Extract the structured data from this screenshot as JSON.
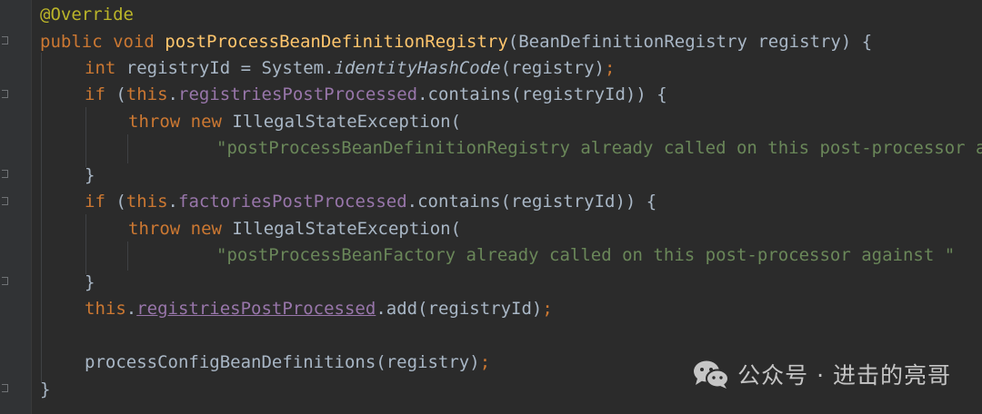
{
  "code": {
    "lines": [
      [
        {
          "cls": "t-ann",
          "text": "@Override"
        }
      ],
      [
        {
          "cls": "t-kw",
          "text": "public void "
        },
        {
          "cls": "t-fn",
          "text": "postProcessBeanDefinitionRegistry"
        },
        {
          "cls": "t-plain",
          "text": "(BeanDefinitionRegistry registry) {"
        }
      ],
      [
        {
          "cls": "t-kw",
          "text": "int "
        },
        {
          "cls": "t-plain",
          "text": "registryId = System."
        },
        {
          "cls": "t-static",
          "text": "identityHashCode"
        },
        {
          "cls": "t-plain",
          "text": "(registry)"
        },
        {
          "cls": "t-kw",
          "text": ";"
        }
      ],
      [
        {
          "cls": "t-kw",
          "text": "if "
        },
        {
          "cls": "t-plain",
          "text": "("
        },
        {
          "cls": "t-kw",
          "text": "this"
        },
        {
          "cls": "t-plain",
          "text": "."
        },
        {
          "cls": "t-field",
          "text": "registriesPostProcessed"
        },
        {
          "cls": "t-plain",
          "text": ".contains(registryId)) {"
        }
      ],
      [
        {
          "cls": "t-kw",
          "text": "throw new "
        },
        {
          "cls": "t-plain",
          "text": "IllegalStateException("
        }
      ],
      [
        {
          "cls": "t-str",
          "text": "\"postProcessBeanDefinitionRegistry already called on this post-processor against \" "
        }
      ],
      [
        {
          "cls": "t-plain",
          "text": "}"
        }
      ],
      [
        {
          "cls": "t-kw",
          "text": "if "
        },
        {
          "cls": "t-plain",
          "text": "("
        },
        {
          "cls": "t-kw",
          "text": "this"
        },
        {
          "cls": "t-plain",
          "text": "."
        },
        {
          "cls": "t-field",
          "text": "factoriesPostProcessed"
        },
        {
          "cls": "t-plain",
          "text": ".contains(registryId)) {"
        }
      ],
      [
        {
          "cls": "t-kw",
          "text": "throw new "
        },
        {
          "cls": "t-plain",
          "text": "IllegalStateException("
        }
      ],
      [
        {
          "cls": "t-str",
          "text": "\"postProcessBeanFactory already called on this post-processor against \" "
        }
      ],
      [
        {
          "cls": "t-plain",
          "text": "}"
        }
      ],
      [
        {
          "cls": "t-kw",
          "text": "this"
        },
        {
          "cls": "t-plain",
          "text": "."
        },
        {
          "cls": "t-link",
          "text": "registriesPostProcessed"
        },
        {
          "cls": "t-plain",
          "text": ".add(registryId)"
        },
        {
          "cls": "t-kw",
          "text": ";"
        }
      ],
      [],
      [
        {
          "cls": "t-plain",
          "text": "processConfigBeanDefinitions(registry)"
        },
        {
          "cls": "t-kw",
          "text": ";"
        }
      ],
      [
        {
          "cls": "t-plain",
          "text": "}"
        }
      ]
    ]
  },
  "watermark": {
    "label": "公众号 · 进击的亮哥",
    "icon": "wechat-icon"
  },
  "colors": {
    "background": "#2b2b2b",
    "keyword": "#cc7832",
    "method": "#ffc66d",
    "field": "#9876aa",
    "string": "#6a8759",
    "annotation": "#bbb529",
    "text": "#a9b7c6"
  }
}
